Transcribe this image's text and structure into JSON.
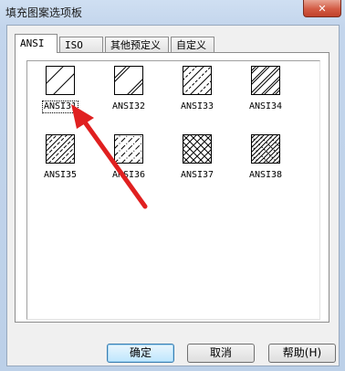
{
  "window": {
    "title": "填充图案选项板",
    "close_glyph": "✕"
  },
  "tabs": [
    {
      "label": "ANSI",
      "active": true
    },
    {
      "label": "ISO",
      "active": false
    },
    {
      "label": "其他预定义",
      "active": false
    },
    {
      "label": "自定义",
      "active": false
    }
  ],
  "patterns": [
    {
      "label": "ANSI31",
      "selected": true
    },
    {
      "label": "ANSI32",
      "selected": false
    },
    {
      "label": "ANSI33",
      "selected": false
    },
    {
      "label": "ANSI34",
      "selected": false
    },
    {
      "label": "ANSI35",
      "selected": false
    },
    {
      "label": "ANSI36",
      "selected": false
    },
    {
      "label": "ANSI37",
      "selected": false
    },
    {
      "label": "ANSI38",
      "selected": false
    }
  ],
  "buttons": {
    "ok": "确定",
    "cancel": "取消",
    "help": "帮助(H)"
  },
  "colors": {
    "annotation_arrow": "#e02020"
  }
}
